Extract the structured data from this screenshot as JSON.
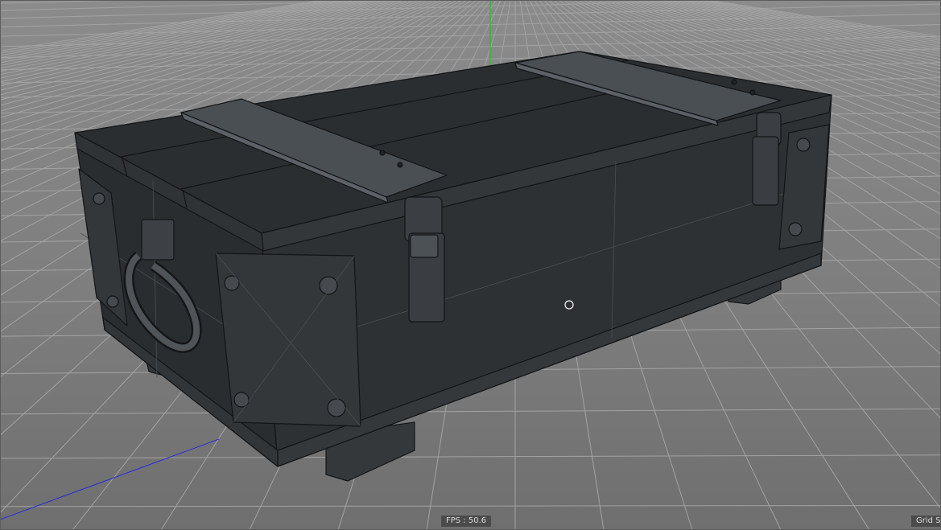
{
  "viewport": {
    "fps_label": "FPS : 50.6",
    "grid_label": "Grid S"
  },
  "colors": {
    "background": "#8a8a8a",
    "grid_line": "#a4a4a4",
    "model_face": "#2c2f32",
    "model_edge": "#15181a",
    "y_axis": "#22c022",
    "x_axis": "#2a2ad8"
  }
}
